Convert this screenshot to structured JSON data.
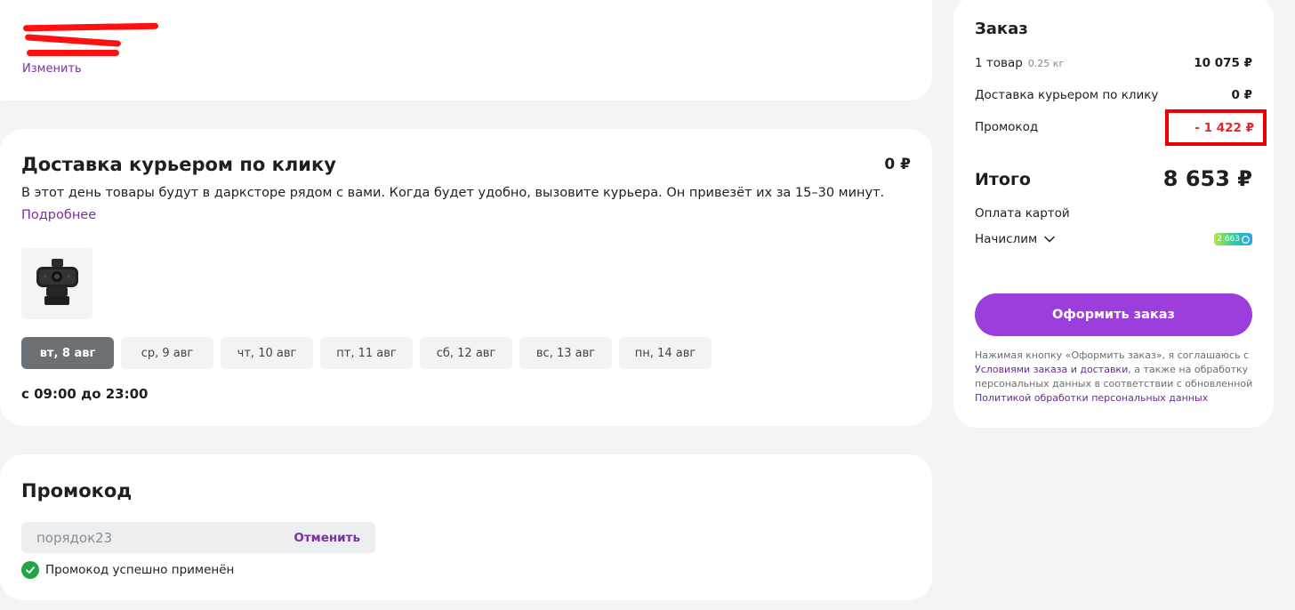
{
  "address": {
    "change_label": "Изменить"
  },
  "delivery": {
    "title": "Доставка курьером по клику",
    "price": "0 ₽",
    "description": "В этот день товары будут в дарксторе рядом с вами. Когда будет удобно, вызовите курьера. Он привезёт их за 15–30 минут.",
    "more_label": "Подробнее",
    "dates": [
      {
        "label": "вт, 8 авг",
        "active": true
      },
      {
        "label": "ср, 9 авг",
        "active": false
      },
      {
        "label": "чт, 10 авг",
        "active": false
      },
      {
        "label": "пт, 11 авг",
        "active": false
      },
      {
        "label": "сб, 12 авг",
        "active": false
      },
      {
        "label": "вс, 13 авг",
        "active": false
      },
      {
        "label": "пн, 14 авг",
        "active": false
      }
    ],
    "time_range": "с 09:00 до 23:00"
  },
  "promo": {
    "title": "Промокод",
    "code": "порядок23",
    "cancel_label": "Отменить",
    "status": "Промокод успешно применён"
  },
  "order": {
    "title": "Заказ",
    "items_label": "1 товар",
    "items_weight": "0.25 кг",
    "items_value": "10 075 ₽",
    "delivery_label": "Доставка курьером по клику",
    "delivery_value": "0 ₽",
    "promo_label": "Промокод",
    "promo_value": "- 1 422 ₽",
    "total_label": "Итого",
    "total_value": "8 653 ₽",
    "payment": "Оплата картой",
    "accrue_label": "Начислим",
    "bonus_value": "2 663",
    "checkout_label": "Оформить заказ",
    "legal_prefix": "Нажимая кнопку «Оформить заказ», я соглашаюсь с ",
    "legal_link1": "Условиями заказа и доставки",
    "legal_middle": ", а также на обработку персональных данных в соответствии с обновленной ",
    "legal_link2": "Политикой обработки персональных данных"
  },
  "colors": {
    "accent": "#9b3edb",
    "link": "#7b2fa3",
    "discount": "#e0282d",
    "success": "#22a447",
    "highlight_box": "#ee0000"
  }
}
